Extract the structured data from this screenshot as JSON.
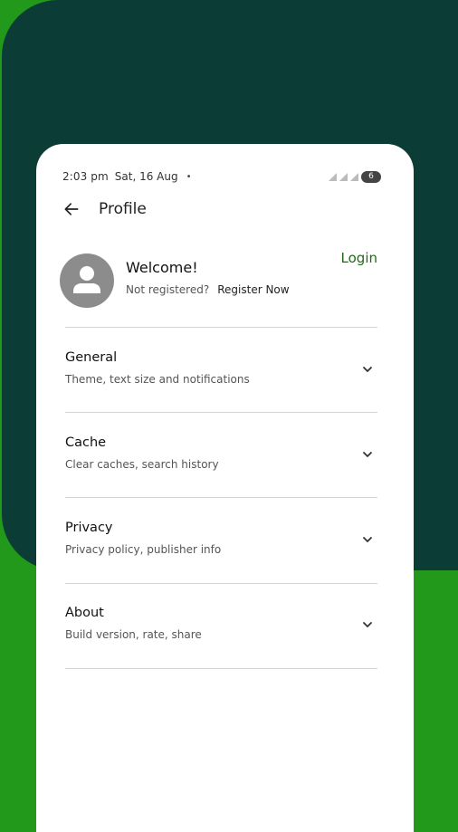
{
  "status": {
    "time": "2:03 pm",
    "date": "Sat, 16 Aug",
    "dot": "•",
    "battery": "6"
  },
  "appbar": {
    "title": "Profile"
  },
  "profile": {
    "welcome": "Welcome!",
    "not_registered": "Not registered?",
    "register_now": "Register Now",
    "login": "Login"
  },
  "sections": [
    {
      "title": "General",
      "subtitle": "Theme, text size and notifications"
    },
    {
      "title": "Cache",
      "subtitle": "Clear caches, search history"
    },
    {
      "title": "Privacy",
      "subtitle": "Privacy policy, publisher info"
    },
    {
      "title": "About",
      "subtitle": "Build version, rate, share"
    }
  ],
  "colors": {
    "accent": "#1f6b16",
    "bg_green": "#22991a",
    "bg_dark": "#0b3d36"
  }
}
